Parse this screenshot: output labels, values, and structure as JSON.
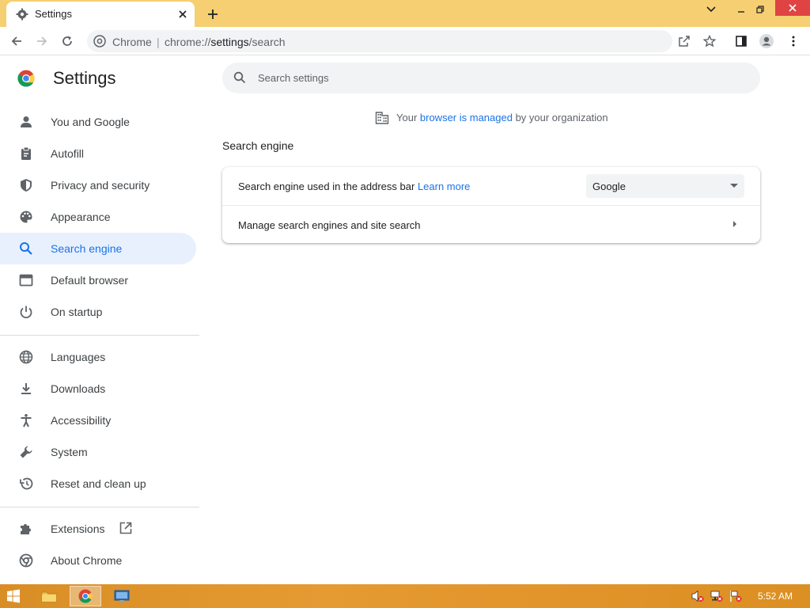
{
  "browser": {
    "tab_title": "Settings",
    "omnibox_chip": "Chrome",
    "omnibox_separator": "|",
    "omnibox_url_scheme": "chrome://",
    "omnibox_url_host": "settings",
    "omnibox_url_path": "/search"
  },
  "settings": {
    "title": "Settings",
    "search_placeholder": "Search settings",
    "managed_prefix": "Your ",
    "managed_link": "browser is managed",
    "managed_suffix": " by your organization",
    "nav_groups": [
      [
        {
          "label": "You and Google",
          "icon": "person-icon"
        },
        {
          "label": "Autofill",
          "icon": "clipboard-icon"
        },
        {
          "label": "Privacy and security",
          "icon": "shield-icon"
        },
        {
          "label": "Appearance",
          "icon": "palette-icon"
        },
        {
          "label": "Search engine",
          "icon": "search-icon",
          "active": true
        },
        {
          "label": "Default browser",
          "icon": "browser-window-icon"
        },
        {
          "label": "On startup",
          "icon": "power-icon"
        }
      ],
      [
        {
          "label": "Languages",
          "icon": "globe-icon"
        },
        {
          "label": "Downloads",
          "icon": "download-icon"
        },
        {
          "label": "Accessibility",
          "icon": "accessibility-icon"
        },
        {
          "label": "System",
          "icon": "wrench-icon"
        },
        {
          "label": "Reset and clean up",
          "icon": "history-icon"
        }
      ],
      [
        {
          "label": "Extensions",
          "icon": "puzzle-icon"
        },
        {
          "label": "About Chrome",
          "icon": "chrome-icon"
        }
      ]
    ],
    "section_title": "Search engine",
    "row1_label": "Search engine used in the address bar ",
    "row1_link": "Learn more",
    "row1_select_value": "Google",
    "row2_label": "Manage search engines and site search"
  },
  "taskbar": {
    "clock": "5:52 AM"
  },
  "colors": {
    "accent": "#1a73e8",
    "titlebar": "#f6cf72",
    "taskbar": "#e0952a",
    "active_nav_bg": "#e8f0fe"
  }
}
